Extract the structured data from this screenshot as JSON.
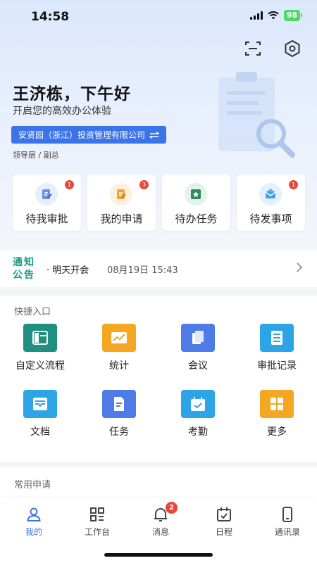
{
  "status": {
    "time": "14:58",
    "battery": "98"
  },
  "header": {
    "greeting": "王济栋，下午好",
    "subtitle": "开启您的高效办公体验",
    "company": "安贤园（浙江）投资管理有限公司",
    "role": "领导层 / 副总"
  },
  "quick_cards": [
    {
      "label": "待我审批",
      "badge": "1",
      "icon": "approval-icon",
      "color": "#6b8fe8"
    },
    {
      "label": "我的申请",
      "badge": "3",
      "icon": "apply-icon",
      "color": "#f0a33c"
    },
    {
      "label": "待办任务",
      "badge": "",
      "icon": "task-icon",
      "color": "#2e8a5c"
    },
    {
      "label": "待发事项",
      "badge": "1",
      "icon": "mail-icon",
      "color": "#3fa0e8"
    }
  ],
  "notice": {
    "tag_line1": "通知",
    "tag_line2": "公告",
    "text": "· 明天开会",
    "time": "08月19日 15:43"
  },
  "quick_entry": {
    "title": "快捷入口",
    "items": [
      {
        "label": "自定义流程",
        "icon": "workflow-icon",
        "color": "#1f8f82"
      },
      {
        "label": "统计",
        "icon": "chart-icon",
        "color": "#f5a623"
      },
      {
        "label": "会议",
        "icon": "meeting-icon",
        "color": "#4e7be6"
      },
      {
        "label": "审批记录",
        "icon": "record-icon",
        "color": "#2ea4e8"
      },
      {
        "label": "文档",
        "icon": "document-icon",
        "color": "#2ea4e8"
      },
      {
        "label": "任务",
        "icon": "task-doc-icon",
        "color": "#4e7be6"
      },
      {
        "label": "考勤",
        "icon": "attendance-icon",
        "color": "#2ea4e8"
      },
      {
        "label": "更多",
        "icon": "more-grid-icon",
        "color": "#f5a623"
      }
    ]
  },
  "common": {
    "title": "常用申请"
  },
  "tabs": [
    {
      "label": "我的",
      "icon": "profile-icon",
      "active": true
    },
    {
      "label": "工作台",
      "icon": "workbench-icon"
    },
    {
      "label": "消息",
      "icon": "bell-icon",
      "badge": "2"
    },
    {
      "label": "日程",
      "icon": "calendar-icon"
    },
    {
      "label": "通讯录",
      "icon": "phone-icon"
    }
  ],
  "colors": {
    "accent": "#3b73e8",
    "notice": "#1d9a8a",
    "badge": "#e8463d"
  }
}
